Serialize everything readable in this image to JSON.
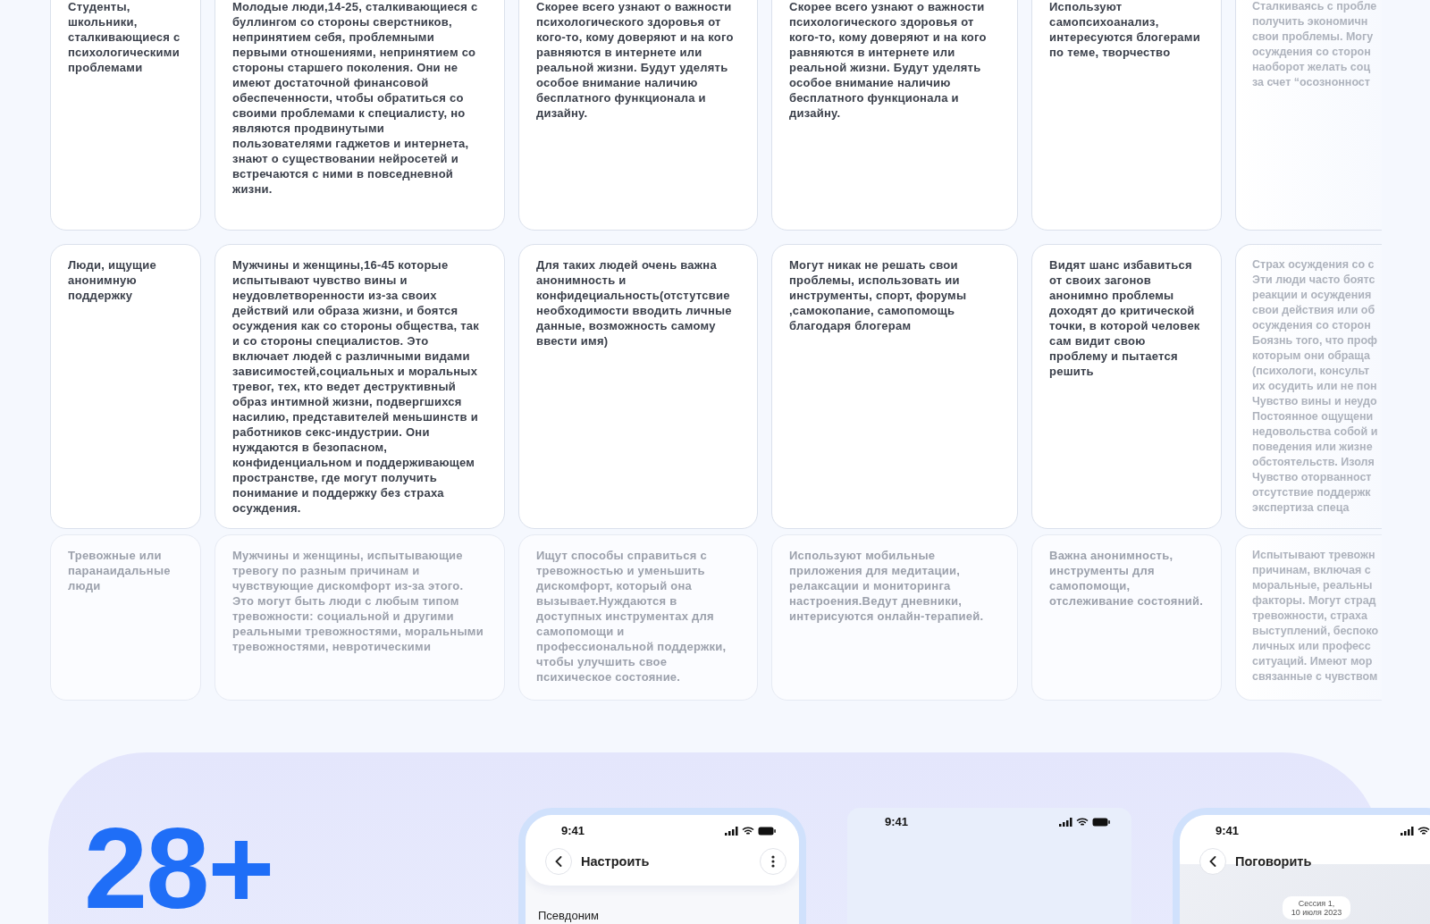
{
  "table": {
    "rows": [
      {
        "faded": false,
        "cells": [
          "Студенты,\nшкольники,\nсталкивающиеся с психологическими проблемами",
          "Молодые люди,14-25, сталкивающиеся с буллингом со стороны сверстников, непринятием себя, проблемными первыми отношениями, непринятием со стороны старшего поколения. Они не имеют достаточной финансовой обеспеченности, чтобы обратиться со своими проблемами к специалисту, но являются продвинутыми пользователями гаджетов и интернета, знают о существовании нейросетей и встречаются с ними в повседневной жизни.",
          "Скорее всего узнают о важности психологического здоровья от кого-то, кому доверяют и на кого равняются в интернете или реальной жизни. Будут уделять особое внимание наличию бесплатного функционала и дизайну.",
          "Скорее всего узнают о важности психологического здоровья от кого-то, кому доверяют и на кого равняются в интернете или реальной жизни. Будут уделять особое внимание наличию бесплатного функционала и дизайну.",
          "Используют самопсихоанализ, интересуются блогерами по теме, творчество",
          "Сталкиваясь с пробле\nполучить экономичн\nсвои проблемы. Могу\nосуждения со сторон\nнаоборот желать соц\nза счет “осознонност"
        ]
      },
      {
        "faded": false,
        "cells": [
          "Люди, ищущие анонимную поддержку",
          "Мужчины и женщины,16-45 которые испытывают чувство вины и неудовлетворенности из-за своих действий или образа жизни, и боятся осуждения как со стороны общества, так и со стороны специалистов. Это включает людей с различными видами зависимостей,социальных и моральных тревог, тех, кто ведет деструктивный образ интимной жизни, подвергшихся насилию, представителей меньшинств и работников секс-индустрии. Они нуждаются в безопасном, конфиденциальном и поддерживающем пространстве, где могут получить понимание и поддержку без страха осуждения.",
          "Для таких людей очень важна анонимность  и конфидециальность(отстутсвие необходимости вводить личные данные, возможность самому ввести имя)",
          "Могут никак не решать свои проблемы, использовать ии инструменты, спорт, форумы ,самокопание, самопомощь благодаря блогерам",
          "Видят шанс избавиться от своих загонов анонимно проблемы доходят до критической точки, в которой человек сам видит свою проблему и пытается решить",
          "Страх осуждения со с\nЭти люди часто боятс\nреакции и осуждения\nсвои действия или об\nосуждения со сторон\nБоязнь того, что проф\nкоторым они обраща\n(психологи, консульт\nих осудить или не пон\nЧувство вины и неудо\nПостоянное ощущени\nнедовольства собой и\nповедения или жизне\nобстоятельств. Изоля\nЧувство оторванност\nотсутствие поддержк\nэкспертиза спеца"
        ]
      },
      {
        "faded": true,
        "cells": [
          "Тревожные или паранаидальные люди",
          "Мужчины и женщины, испытывающие тревогу по разным причинам и чувствующие дискомфорт из-за этого. Это могут быть люди с любым типом тревожности: социальной и другими реальными тревожностями, моральными тревожностями, невротическими",
          "Ищут способы справиться с тревожностью и уменьшить дискомфорт, который она вызывает.Нуждаются в доступных инструментах для самопомощи и профессиональной поддержки, чтобы улучшить свое психическое состояние.",
          "Используют мобильные приложения для медитации, релаксации и мониторинга настроения.Ведут дневники, интерисуются онлайн-терапией.",
          "Важна анонимность, инструменты для самопомощи, отслеживание состояний.",
          "Испытывают тревожн\nпричинам, включая с\nморальные, реальны\nфакторы. Могут страд\nтревожности, страха\nвыступлений, беспоко\nличных или професс\nситуаций. Имеют мор\nсвязанные с чувством"
        ]
      }
    ]
  },
  "stat": {
    "value": "28+"
  },
  "phones": [
    {
      "kind": "settings",
      "time": "9:41",
      "title": "Настроить",
      "field_label": "Псевдоним"
    },
    {
      "kind": "blank",
      "time": "9:41"
    },
    {
      "kind": "chat",
      "time": "9:41",
      "title": "Поговорить",
      "session_chip": "Сессия 1,\n10 июля 2023"
    }
  ]
}
